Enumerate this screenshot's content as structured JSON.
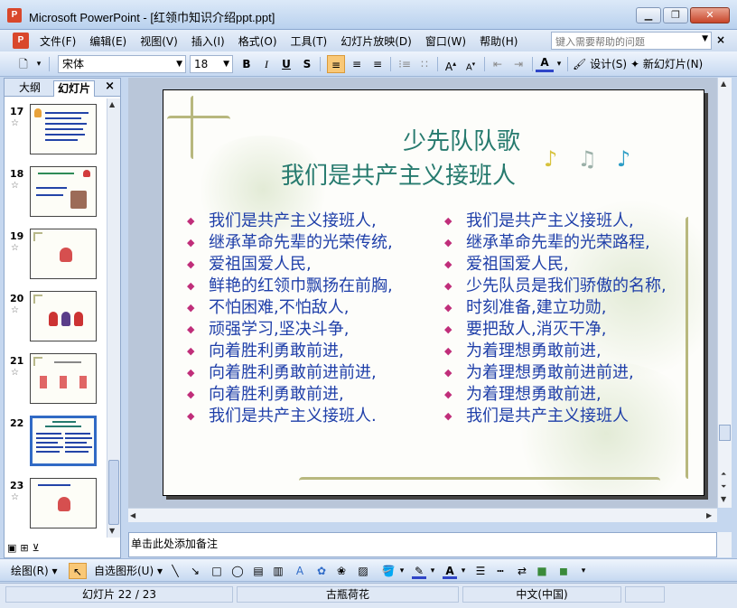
{
  "window": {
    "app_icon": "P",
    "title": "Microsoft PowerPoint - [红领巾知识介绍ppt.ppt]",
    "buttons": {
      "minimize": "▁",
      "restore": "❐",
      "close": "✕"
    }
  },
  "menubar": {
    "items": [
      "文件(F)",
      "编辑(E)",
      "视图(V)",
      "插入(I)",
      "格式(O)",
      "工具(T)",
      "幻灯片放映(D)",
      "窗口(W)",
      "帮助(H)"
    ],
    "help_placeholder": "键入需要帮助的问题",
    "close_glyph": "×"
  },
  "format_toolbar": {
    "font_name": "宋体",
    "font_size": "18",
    "bold": "B",
    "italic": "I",
    "underline": "U",
    "shadow": "S",
    "design_label": "设计(S)",
    "new_slide_label": "新幻灯片(N)"
  },
  "left_pane": {
    "tab_outline": "大纲",
    "tab_slides": "幻灯片",
    "close_glyph": "×",
    "thumbnails": [
      {
        "num": "17",
        "selected": false
      },
      {
        "num": "18",
        "selected": false
      },
      {
        "num": "19",
        "selected": false
      },
      {
        "num": "20",
        "selected": false
      },
      {
        "num": "21",
        "selected": false
      },
      {
        "num": "22",
        "selected": true
      },
      {
        "num": "23",
        "selected": false
      }
    ]
  },
  "slide": {
    "title_line1": "少先队队歌",
    "title_line2": "我们是共产主义接班人",
    "bullet_glyph": "◆",
    "left_column": [
      "我们是共产主义接班人,",
      "继承革命先辈的光荣传统,",
      "爱祖国爱人民,",
      "鲜艳的红领巾飘扬在前胸,",
      "不怕困难,不怕敌人,",
      "顽强学习,坚决斗争,",
      "向着胜利勇敢前进,",
      "向着胜利勇敢前进前进,",
      "向着胜利勇敢前进,",
      "我们是共产主义接班人."
    ],
    "right_column": [
      "我们是共产主义接班人,",
      "继承革命先辈的光荣路程,",
      "爱祖国爱人民,",
      "少先队员是我们骄傲的名称,",
      "时刻准备,建立功勋,",
      "要把敌人,消灭干净,",
      "为着理想勇敢前进,",
      "为着理想勇敢前进前进,",
      "为着理想勇敢前进,",
      "我们是共产主义接班人"
    ]
  },
  "notes": {
    "placeholder": "单击此处添加备注"
  },
  "draw_toolbar": {
    "draw_label": "绘图(R)",
    "autoshapes_label": "自选图形(U)"
  },
  "statusbar": {
    "slide_position": "幻灯片 22 / 23",
    "design_template": "古瓶荷花",
    "language": "中文(中国)"
  },
  "colors": {
    "title_teal": "#267a6e",
    "lyric_blue": "#1f3fa9",
    "bullet_magenta": "#c02e7a",
    "vine": "#b8b87e",
    "selection_blue": "#316ac5"
  }
}
